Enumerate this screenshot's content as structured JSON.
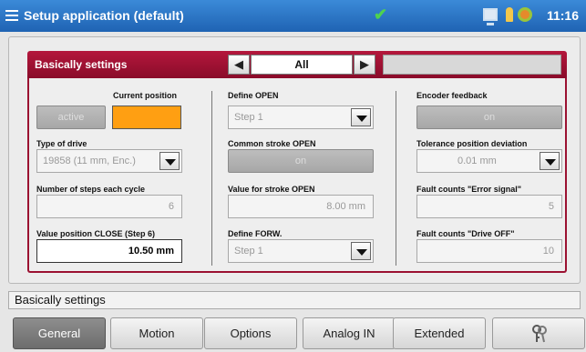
{
  "titlebar": {
    "title": "Setup application (default)",
    "time": "11:16",
    "icons": [
      "menu-icon",
      "check-icon",
      "pc-icon",
      "person-icon",
      "gear-icon"
    ]
  },
  "section": {
    "title": "Basically settings",
    "selector_value": "All"
  },
  "left_col": {
    "current_position_label": "Current position",
    "active_button": "active",
    "type_of_drive_label": "Type of drive",
    "type_of_drive_value": "19858 (11 mm, Enc.)",
    "steps_label": "Number of steps each cycle",
    "steps_value": "6",
    "close_label": "Value position CLOSE (Step 6)",
    "close_value": "10.50  mm"
  },
  "mid_col": {
    "define_open_label": "Define OPEN",
    "define_open_value": "Step 1",
    "common_stroke_label": "Common stroke OPEN",
    "common_stroke_button": "on",
    "stroke_open_label": "Value for stroke OPEN",
    "stroke_open_value": "8.00  mm",
    "define_forw_label": "Define FORW.",
    "define_forw_value": "Step 1"
  },
  "right_col": {
    "encoder_label": "Encoder feedback",
    "encoder_button": "on",
    "tolerance_label": "Tolerance position deviation",
    "tolerance_value": "0.01 mm",
    "fault_error_label": "Fault counts \"Error signal\"",
    "fault_error_value": "5",
    "fault_drive_label": "Fault counts \"Drive OFF\"",
    "fault_drive_value": "10"
  },
  "status": {
    "text": "Basically settings"
  },
  "tabs": [
    {
      "label": "General",
      "selected": true
    },
    {
      "label": "Motion",
      "selected": false
    },
    {
      "label": "Options",
      "selected": false
    },
    {
      "label": "Analog IN",
      "selected": false
    },
    {
      "label": "Extended",
      "selected": false
    },
    {
      "label": "",
      "icon": "key-icon",
      "selected": false
    }
  ],
  "colors": {
    "titlebar": "#2a74c8",
    "section_header": "#9b1131",
    "current_position_indicator": "#ff9f12",
    "check": "#4fd24f"
  }
}
